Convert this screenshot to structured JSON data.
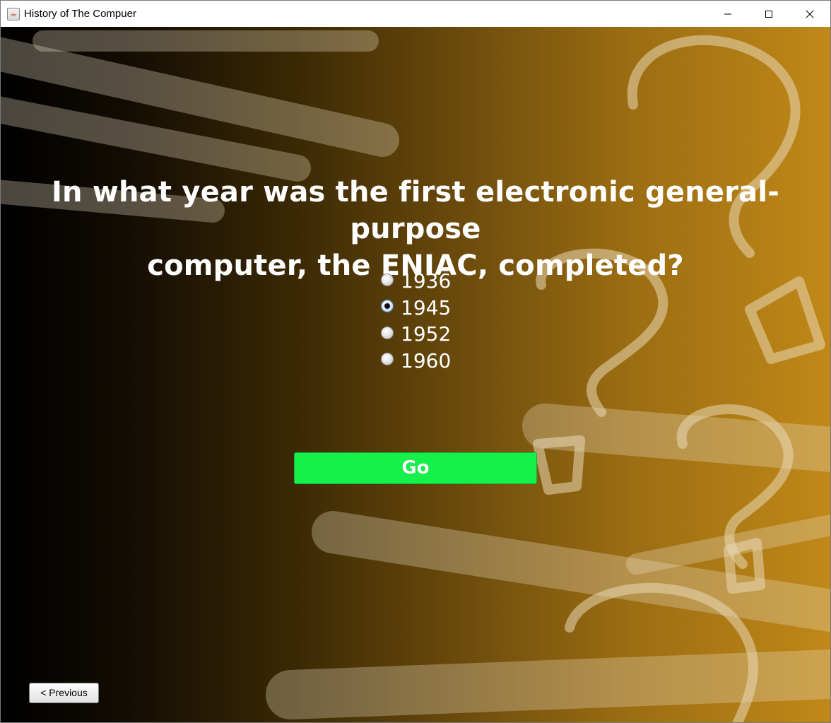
{
  "window": {
    "title": "History of The Compuer",
    "controls": [
      "minimize",
      "maximize",
      "close"
    ]
  },
  "quiz": {
    "question_line1": "In what year was the first electronic general-purpose",
    "question_line2": "computer, the ENIAC, completed?",
    "options": [
      {
        "label": "1936",
        "selected": false
      },
      {
        "label": "1945",
        "selected": true
      },
      {
        "label": "1952",
        "selected": false
      },
      {
        "label": "1960",
        "selected": false
      }
    ],
    "go_label": "Go",
    "previous_label": "< Previous"
  },
  "colors": {
    "background_start": "#000000",
    "background_end": "#c08818",
    "go_button": "#16f04a",
    "text": "#ffffff"
  },
  "icons": {
    "app": "java-coffee-cup-icon",
    "decorations": "question-mark-doodles"
  }
}
